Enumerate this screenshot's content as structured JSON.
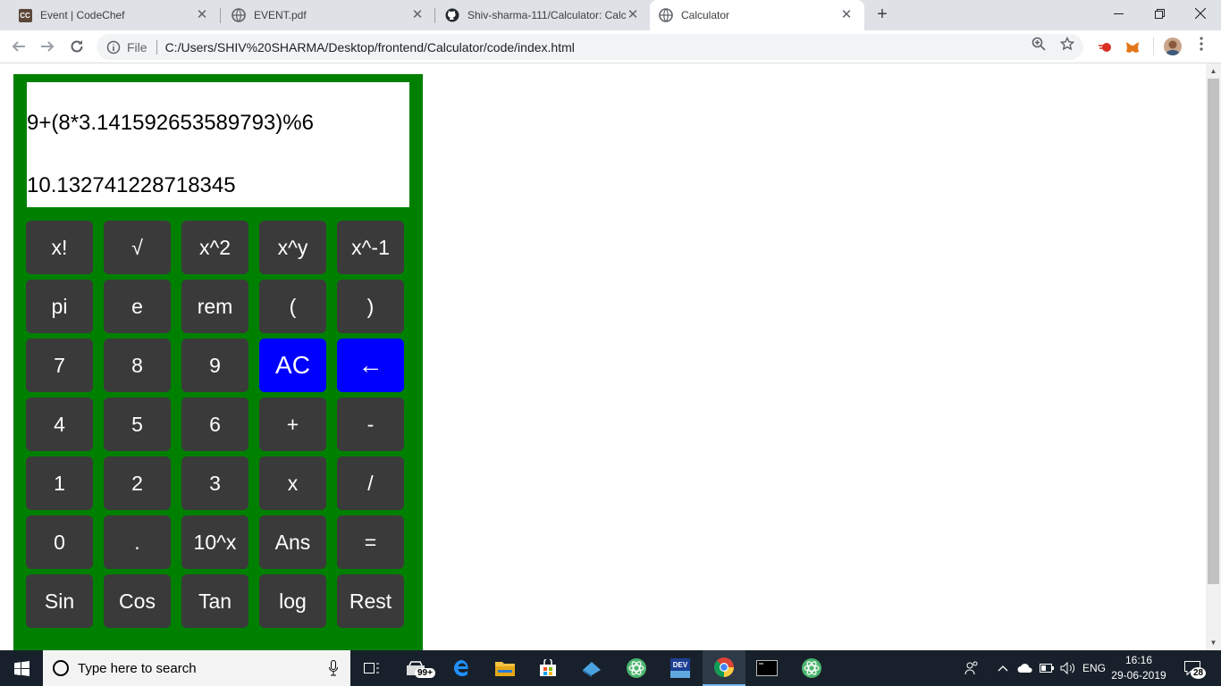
{
  "browser": {
    "tabs": [
      {
        "title": "Event | CodeChef",
        "favicon": "codechef-icon",
        "favicon_text": "CC"
      },
      {
        "title": "EVENT.pdf",
        "favicon": "globe-icon"
      },
      {
        "title": "Shiv-sharma-111/Calculator: Calc",
        "favicon": "github-icon"
      },
      {
        "title": "Calculator",
        "favicon": "globe-icon"
      }
    ],
    "active_tab": 3,
    "scheme_label": "File",
    "url": "C:/Users/SHIV%20SHARMA/Desktop/frontend/Calculator/code/index.html"
  },
  "calculator": {
    "expression": "9+(8*3.141592653589793)%6",
    "result": "10.132741228718345",
    "keys": [
      [
        "x!",
        "√",
        "x^2",
        "x^y",
        "x^-1"
      ],
      [
        "pi",
        "e",
        "rem",
        "(",
        ")"
      ],
      [
        "7",
        "8",
        "9",
        "AC",
        "←"
      ],
      [
        "4",
        "5",
        "6",
        "+",
        "-"
      ],
      [
        "1",
        "2",
        "3",
        "x",
        "/"
      ],
      [
        "0",
        ".",
        "10^x",
        "Ans",
        "="
      ],
      [
        "Sin",
        "Cos",
        "Tan",
        "log",
        "Rest"
      ]
    ],
    "colors": {
      "body": "#008000",
      "key": "#3a3a3a",
      "accent_key": "#0000ff",
      "display": "#ffffff"
    }
  },
  "taskbar": {
    "search_placeholder": "Type here to search",
    "store_badge": "99+",
    "language": "ENG",
    "time": "16:16",
    "date": "29-06-2019",
    "notification_count": "28"
  }
}
